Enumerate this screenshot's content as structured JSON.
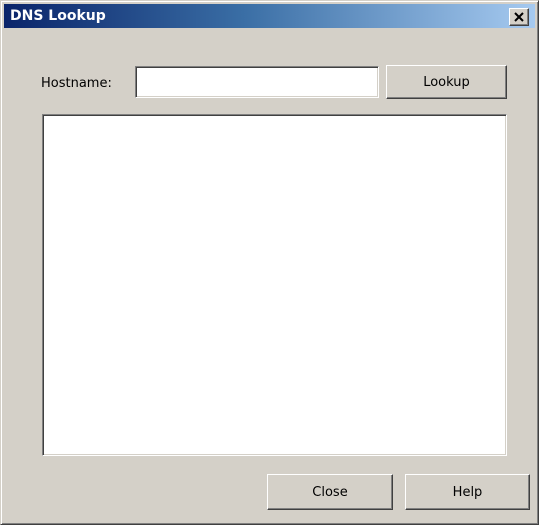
{
  "window": {
    "title": "DNS Lookup"
  },
  "titlebar_buttons": {
    "close_icon": "close-icon"
  },
  "form": {
    "hostname_label": "Hostname:",
    "hostname_value": "",
    "hostname_placeholder": "",
    "lookup_label": "Lookup"
  },
  "results": {
    "text": ""
  },
  "footer": {
    "close_label": "Close",
    "help_label": "Help"
  },
  "colors": {
    "titlebar_start": "#0a246a",
    "titlebar_end": "#a6caf0",
    "window_bg": "#d4d0c8",
    "field_bg": "#ffffff"
  }
}
